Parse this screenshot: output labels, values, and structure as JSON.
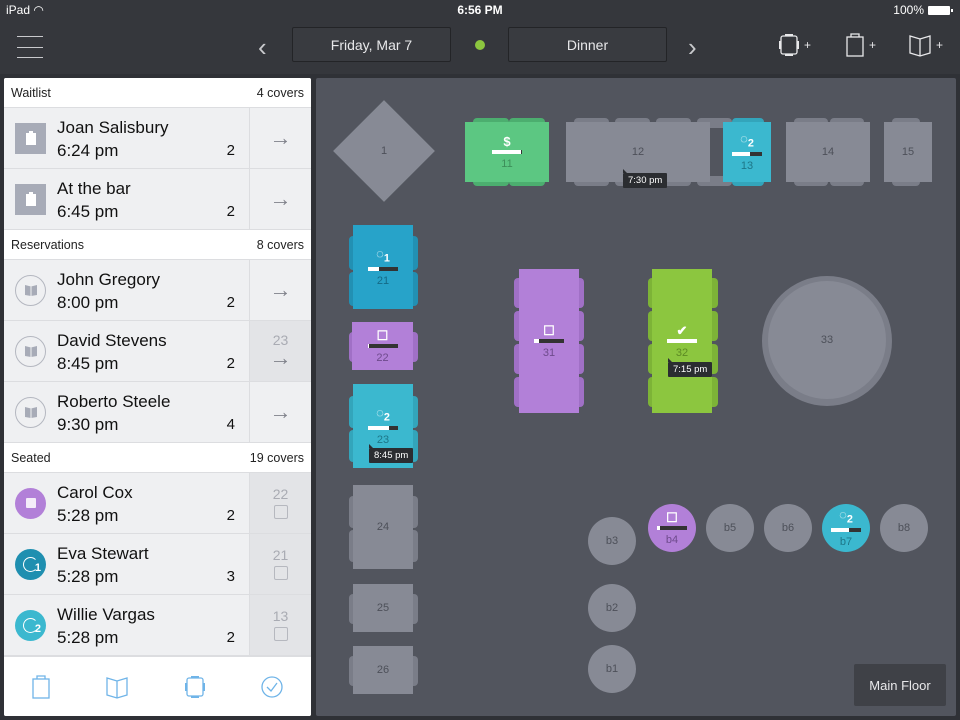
{
  "status_bar": {
    "carrier": "iPad",
    "time": "6:56 PM",
    "battery": "100%"
  },
  "toolbar": {
    "date": "Friday, Mar 7",
    "shift": "Dinner",
    "shift_status_color": "#8cc63f",
    "add_table_label": "+",
    "add_waitlist_label": "+",
    "add_reservation_label": "+"
  },
  "sidebar": {
    "waitlist": {
      "title": "Waitlist",
      "covers": "4 covers",
      "items": [
        {
          "name": "Joan Salisbury",
          "time": "6:24 pm",
          "covers": "2",
          "action": "→"
        },
        {
          "name": "At the bar",
          "time": "6:45 pm",
          "covers": "2",
          "action": "→"
        }
      ]
    },
    "reservations": {
      "title": "Reservations",
      "covers": "8 covers",
      "items": [
        {
          "name": "John Gregory",
          "time": "8:00 pm",
          "covers": "2",
          "table": "",
          "action": "→"
        },
        {
          "name": "David Stevens",
          "time": "8:45 pm",
          "covers": "2",
          "table": "23",
          "action": "→"
        },
        {
          "name": "Roberto Steele",
          "time": "9:30 pm",
          "covers": "4",
          "table": "",
          "action": "→"
        }
      ]
    },
    "seated": {
      "title": "Seated",
      "covers": "19 covers",
      "items": [
        {
          "name": "Carol Cox",
          "time": "5:28 pm",
          "covers": "2",
          "table": "22",
          "status": "seated",
          "color": "#b280d8",
          "badge": ""
        },
        {
          "name": "Eva Stewart",
          "time": "5:28 pm",
          "covers": "3",
          "table": "21",
          "status": "course",
          "color": "#1f8fb0",
          "badge": "1"
        },
        {
          "name": "Willie Vargas",
          "time": "5:28 pm",
          "covers": "2",
          "table": "13",
          "status": "course",
          "color": "#3bb8cf",
          "badge": "2"
        }
      ]
    },
    "bottom_tabs": [
      "waitlist",
      "reservations",
      "tables",
      "completed"
    ]
  },
  "floor": {
    "name": "Main Floor",
    "tables": {
      "t1": {
        "label": "1"
      },
      "t11": {
        "label": "11",
        "icon": "$",
        "progress": 0.95
      },
      "t12": {
        "label": "12",
        "tag": "7:30 pm"
      },
      "t13": {
        "label": "13",
        "badge": "2",
        "progress": 0.6
      },
      "t14": {
        "label": "14"
      },
      "t15": {
        "label": "15"
      },
      "t21": {
        "label": "21",
        "badge": "1",
        "progress": 0.35
      },
      "t22": {
        "label": "22",
        "progress": 0.05
      },
      "t23": {
        "label": "23",
        "badge": "2",
        "progress": 0.7,
        "tag": "8:45 pm"
      },
      "t24": {
        "label": "24"
      },
      "t25": {
        "label": "25"
      },
      "t26": {
        "label": "26"
      },
      "t31": {
        "label": "31",
        "progress": 0.15
      },
      "t32": {
        "label": "32",
        "icon": "✔",
        "progress": 1.0,
        "tag": "7:15 pm"
      },
      "t33": {
        "label": "33"
      },
      "b1": {
        "label": "b1"
      },
      "b2": {
        "label": "b2"
      },
      "b3": {
        "label": "b3"
      },
      "b4": {
        "label": "b4",
        "progress": 0.1
      },
      "b5": {
        "label": "b5"
      },
      "b6": {
        "label": "b6"
      },
      "b7": {
        "label": "b7",
        "badge": "2",
        "progress": 0.6
      },
      "b8": {
        "label": "b8"
      }
    }
  }
}
